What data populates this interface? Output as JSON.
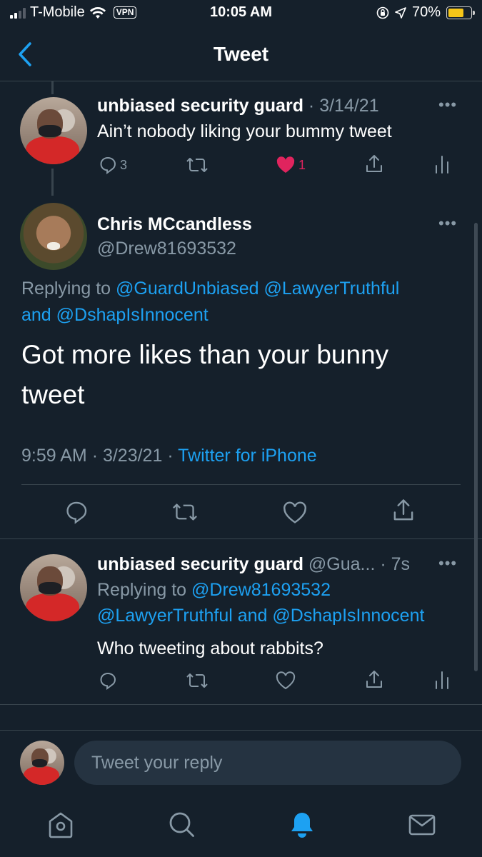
{
  "status": {
    "carrier": "T-Mobile",
    "vpn": "VPN",
    "time": "10:05 AM",
    "battery": "70%",
    "battery_level": 0.7
  },
  "nav": {
    "title": "Tweet"
  },
  "parent_tweet": {
    "name": "unbiased security guard",
    "meta": "· 3/14/21",
    "text": "Ain’t nobody liking your bummy tweet",
    "reply_count": "3",
    "like_count": "1"
  },
  "main_tweet": {
    "name": "Chris MCcandless",
    "handle": "@Drew81693532",
    "replying_label": "Replying to",
    "mention1": "@GuardUnbiased",
    "mention2": "@LawyerTruthful",
    "and": "and",
    "mention3": "@DshapIsInnocent",
    "text_line1": "Got more likes than your bunny",
    "text_line2": "tweet",
    "time": "9:59 AM",
    "date": "· 3/23/21 ·",
    "source": "Twitter for iPhone"
  },
  "reply_tweet": {
    "name": "unbiased security guard",
    "handle": "@Gua...",
    "age": "· 7s",
    "replying_label": "Replying to",
    "mention1": "@Drew81693532",
    "mention2": "@LawyerTruthful",
    "and": "and",
    "mention3": "@DshapIsInnocent",
    "text": "Who tweeting about rabbits?"
  },
  "composer": {
    "placeholder": "Tweet your reply"
  },
  "colors": {
    "background": "#15202b",
    "accent": "#1da1f2",
    "muted": "#8899a6",
    "like": "#e0245e"
  }
}
